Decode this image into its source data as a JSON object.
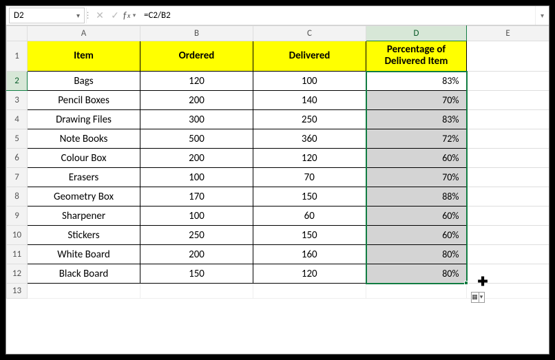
{
  "name_box": "D2",
  "formula": "=C2/B2",
  "col_headers": [
    "A",
    "B",
    "C",
    "D",
    "E"
  ],
  "selected_col": "D",
  "selected_row": "2",
  "header": {
    "item": "Item",
    "ordered": "Ordered",
    "delivered": "Delivered",
    "pct": "Percentage of Delivered Item"
  },
  "rows": [
    {
      "n": "2",
      "item": "Bags",
      "ordered": "120",
      "delivered": "100",
      "pct": "83%"
    },
    {
      "n": "3",
      "item": "Pencil Boxes",
      "ordered": "200",
      "delivered": "140",
      "pct": "70%"
    },
    {
      "n": "4",
      "item": "Drawing Files",
      "ordered": "300",
      "delivered": "250",
      "pct": "83%"
    },
    {
      "n": "5",
      "item": "Note Books",
      "ordered": "500",
      "delivered": "360",
      "pct": "72%"
    },
    {
      "n": "6",
      "item": "Colour Box",
      "ordered": "200",
      "delivered": "120",
      "pct": "60%"
    },
    {
      "n": "7",
      "item": "Erasers",
      "ordered": "100",
      "delivered": "70",
      "pct": "70%"
    },
    {
      "n": "8",
      "item": "Geometry Box",
      "ordered": "170",
      "delivered": "150",
      "pct": "88%"
    },
    {
      "n": "9",
      "item": "Sharpener",
      "ordered": "100",
      "delivered": "60",
      "pct": "60%"
    },
    {
      "n": "10",
      "item": "Stickers",
      "ordered": "250",
      "delivered": "150",
      "pct": "60%"
    },
    {
      "n": "11",
      "item": "White Board",
      "ordered": "200",
      "delivered": "160",
      "pct": "80%"
    },
    {
      "n": "12",
      "item": "Black Board",
      "ordered": "150",
      "delivered": "120",
      "pct": "80%"
    }
  ],
  "blank_row": "13"
}
